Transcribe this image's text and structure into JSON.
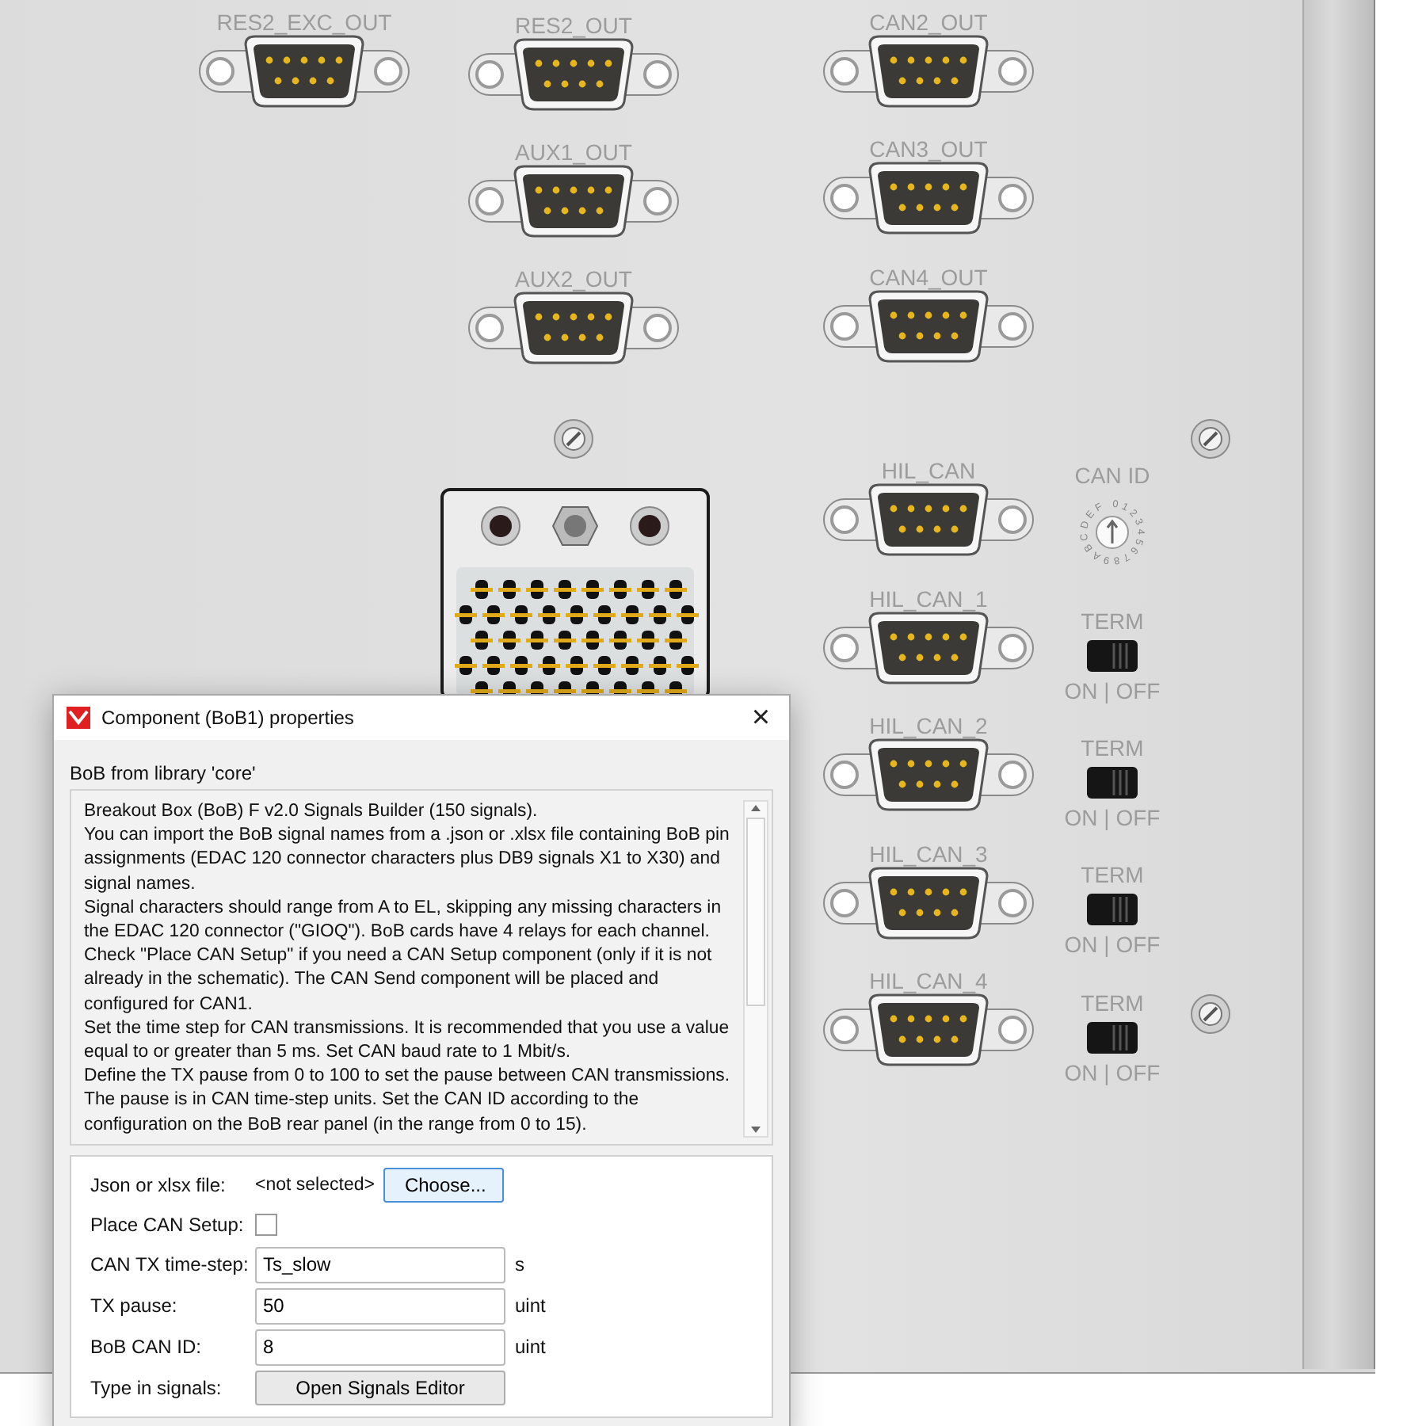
{
  "panel": {
    "connectors": [
      {
        "label": "RES2_EXC_OUT"
      },
      {
        "label": "RES2_OUT"
      },
      {
        "label": "CAN2_OUT"
      },
      {
        "label": "AUX1_OUT"
      },
      {
        "label": "CAN3_OUT"
      },
      {
        "label": "AUX2_OUT"
      },
      {
        "label": "CAN4_OUT"
      },
      {
        "label": "HIL_CAN"
      },
      {
        "label": "HIL_CAN_1"
      },
      {
        "label": "HIL_CAN_2"
      },
      {
        "label": "HIL_CAN_3"
      },
      {
        "label": "HIL_CAN_4"
      }
    ],
    "can_id": {
      "label": "CAN ID",
      "dial_labels": "0123456789ABCDEF"
    },
    "term_switches": [
      {
        "label": "TERM",
        "states": "ON | OFF"
      },
      {
        "label": "TERM",
        "states": "ON | OFF"
      },
      {
        "label": "TERM",
        "states": "ON | OFF"
      },
      {
        "label": "TERM",
        "states": "ON | OFF"
      }
    ]
  },
  "dialog": {
    "title": "Component (BoB1) properties",
    "close": "×",
    "library": "BoB from library 'core'",
    "description": [
      "Breakout Box (BoB) F v2.0 Signals Builder (150 signals).",
      "You can import the BoB signal names from a .json or .xlsx file containing BoB pin assignments (EDAC 120 connector characters plus DB9 signals X1 to X30) and signal names.",
      "Signal characters should range from A to EL, skipping any missing characters in the EDAC 120 connector (\"GIOQ\"). BoB cards have 4 relays for each channel.",
      "Check \"Place CAN Setup\" if you need a CAN Setup component (only if it is not already in the schematic). The CAN Send component will be placed and configured for CAN1.",
      "Set the time step for CAN transmissions. It is recommended that you use a value equal to or greater than 5 ms. Set CAN baud rate to 1 Mbit/s.",
      "Define the TX pause from 0 to 100 to set the pause between CAN transmissions. The pause is in CAN time-step units. Set the CAN ID according to the configuration on the BoB rear panel (in the range from 0 to 15)."
    ],
    "fields": [
      {
        "kind": "file",
        "label": "Json or xlsx file:",
        "value": "<not selected>",
        "button": "Choose..."
      },
      {
        "kind": "checkbox",
        "label": "Place CAN Setup:",
        "checked": false
      },
      {
        "kind": "text",
        "label": "CAN TX time-step:",
        "value": "Ts_slow",
        "unit": "s"
      },
      {
        "kind": "text",
        "label": "TX pause:",
        "value": "50",
        "unit": "uint"
      },
      {
        "kind": "text",
        "label": "BoB CAN ID:",
        "value": "8",
        "unit": "uint"
      },
      {
        "kind": "button",
        "label": "Type in signals:",
        "button": "Open Signals Editor"
      }
    ]
  }
}
